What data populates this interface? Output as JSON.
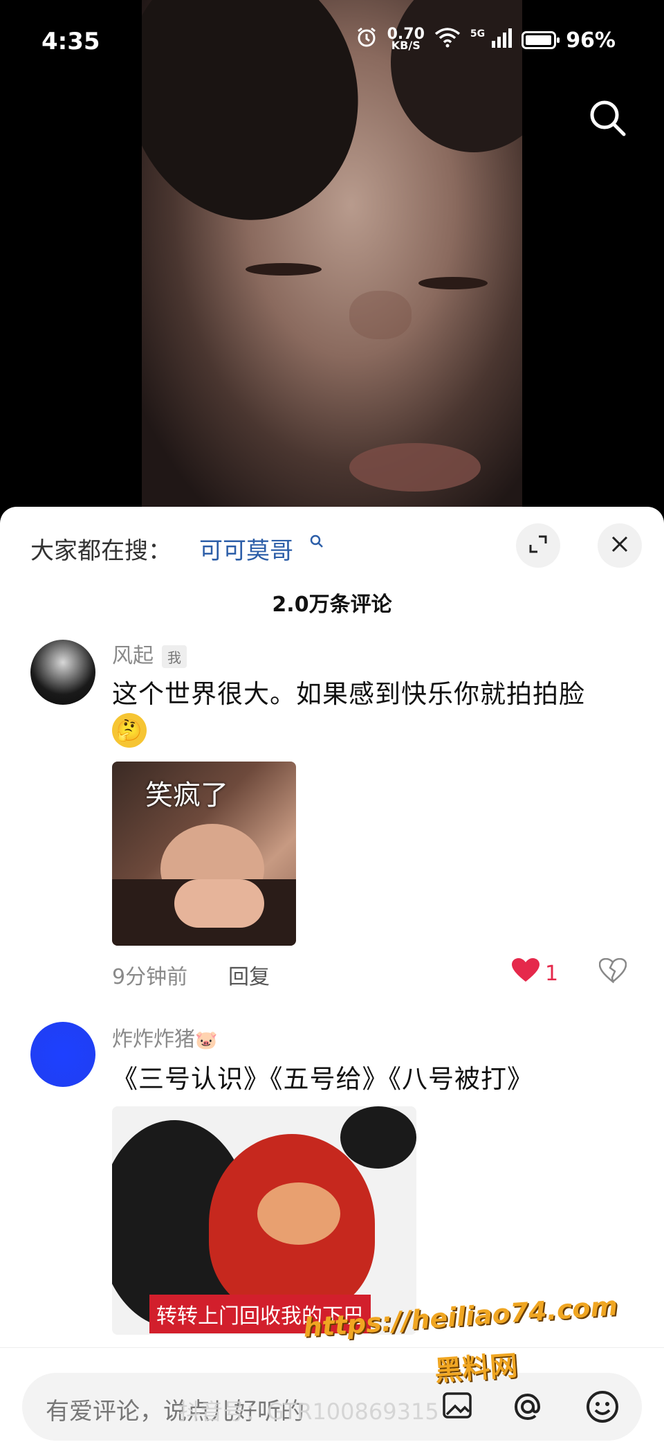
{
  "status_bar": {
    "time": "4:35",
    "net_speed": "0.70",
    "net_unit": "KB/S",
    "net_type": "5G",
    "battery": "96%"
  },
  "search_bar": {
    "label": "大家都在搜：",
    "term": "可可莫哥"
  },
  "comments_header": {
    "count": "2.0万条评论"
  },
  "comments": [
    {
      "username": "风起",
      "badge": "我",
      "text": "这个世界很大。如果感到快乐你就拍拍脸",
      "image_caption": "笑疯了",
      "time": "9分钟前",
      "reply": "回复",
      "likes": "1"
    },
    {
      "username": "炸炸炸猪",
      "text": "《三号认识》《五号给》《八号被打》",
      "image_caption": "转转上门回收我的下巴"
    }
  ],
  "input": {
    "placeholder": "有爱评论，说点儿好听的"
  },
  "watermark": {
    "url": "https://heiliao74.com",
    "site": "黑料网",
    "douyin_id": "抖音号：GTR100869315"
  },
  "colors": {
    "accent_link": "#2c5ea8",
    "like_red": "#e5294b"
  }
}
